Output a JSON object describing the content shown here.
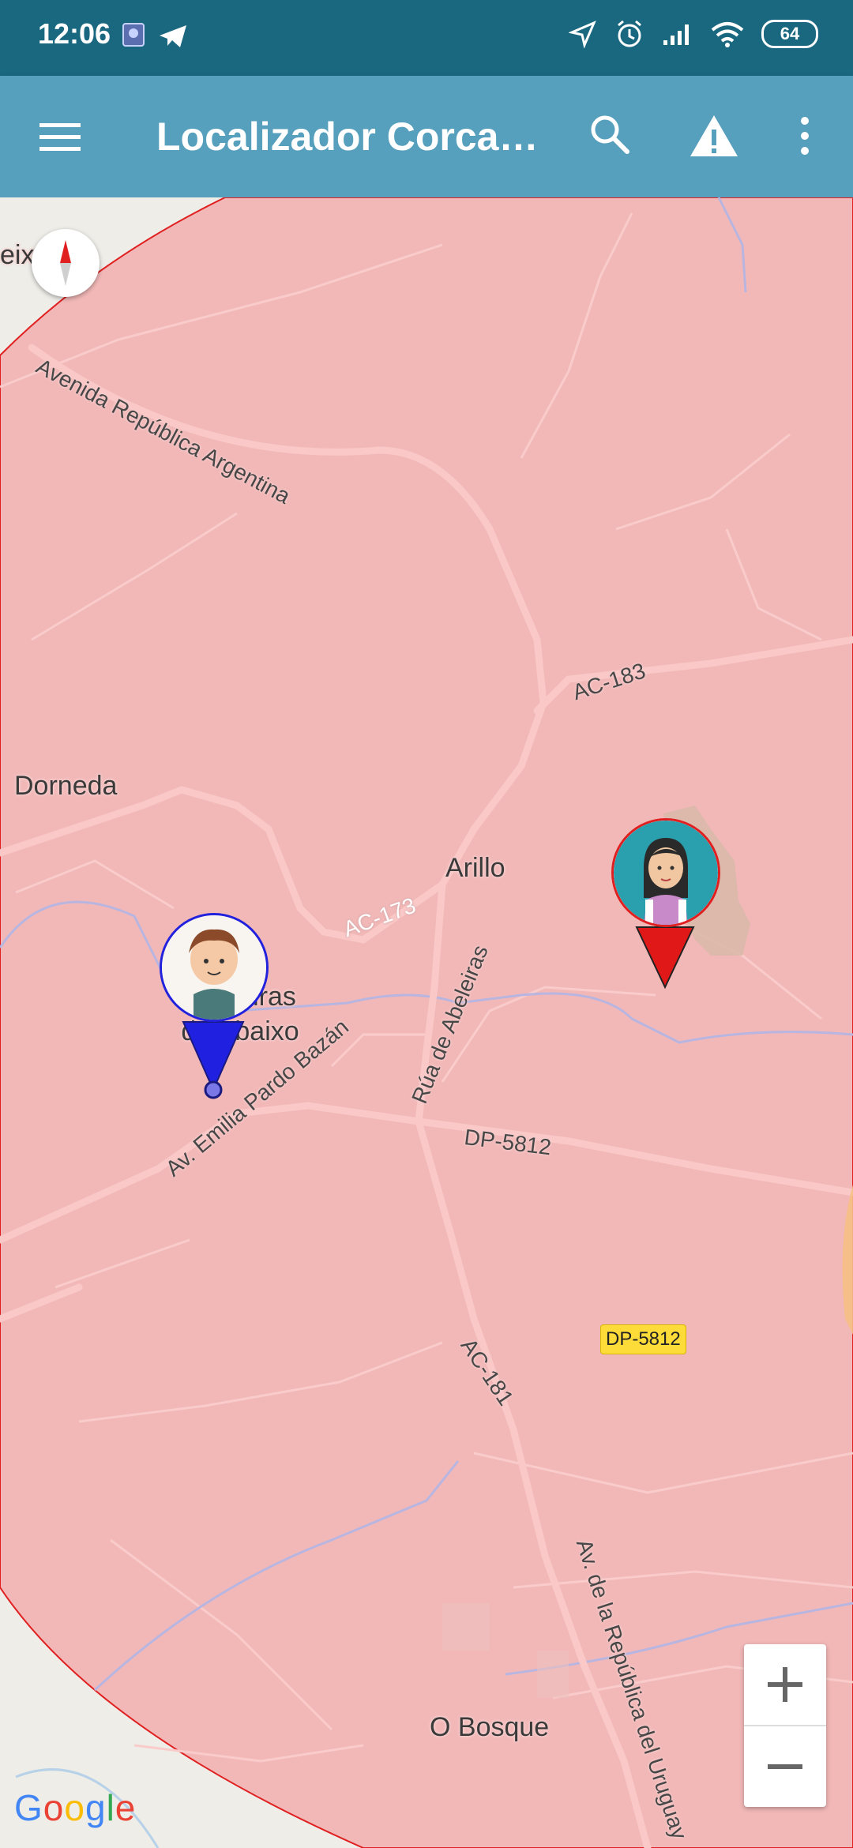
{
  "status_bar": {
    "time": "12:06",
    "battery": "64",
    "icons": [
      "photo-icon",
      "telegram-icon",
      "location-icon",
      "alarm-icon",
      "signal-icon",
      "wifi-icon",
      "battery-icon"
    ]
  },
  "app_bar": {
    "title": "Localizador Corca…",
    "icons": [
      "menu-icon",
      "search-icon",
      "warning-icon",
      "more-icon"
    ]
  },
  "colors": {
    "status_bar": "#1a6880",
    "app_bar": "#56a0bd",
    "zone_fill": "#f2b8b8",
    "zone_border": "#e02020",
    "marker_blue": "#2020e0",
    "marker_red": "#e01818"
  },
  "map": {
    "places": {
      "eixo": "eixo",
      "dorneda": "Dorneda",
      "arillo": "Arillo",
      "abeleiras": "Abeleiras de Abaixo",
      "o_bosque": "O Bosque"
    },
    "roads": {
      "avenida_republica_argentina": "Avenida República Argentina",
      "ac183": "AC-183",
      "ac173": "AC-173",
      "rua_abeleiras": "Rúa de Abeleiras",
      "dp5812": "DP-5812",
      "dp5812_shield": "DP-5812",
      "av_emilia": "Av. Emilia Pardo Bazán",
      "ac181": "AC-181",
      "av_uruguay": "Av. de la República del Uruguay"
    },
    "markers": [
      {
        "name": "boy-marker",
        "color": "blue"
      },
      {
        "name": "girl-marker",
        "color": "red"
      }
    ],
    "zoom_in": "+",
    "zoom_out": "−",
    "attribution": "Google"
  }
}
